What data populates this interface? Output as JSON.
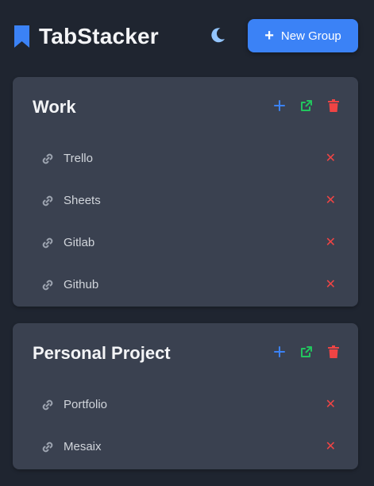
{
  "app": {
    "title": "TabStacker",
    "new_group_label": "New Group",
    "accent": "#3b82f6"
  },
  "icons": {
    "brand": "bookmark-icon",
    "theme": "moon-icon",
    "add": "plus-icon",
    "open": "external-link-icon",
    "delete": "trash-icon",
    "tab": "link-icon",
    "remove": "close-icon"
  },
  "groups": [
    {
      "title": "Work",
      "tabs": [
        {
          "label": "Trello"
        },
        {
          "label": "Sheets"
        },
        {
          "label": "Gitlab"
        },
        {
          "label": "Github"
        }
      ]
    },
    {
      "title": "Personal Project",
      "tabs": [
        {
          "label": "Portfolio"
        },
        {
          "label": "Mesaix"
        }
      ]
    }
  ],
  "colors": {
    "add": "#3b82f6",
    "open": "#22c55e",
    "delete": "#ef4444",
    "remove": "#ef4444"
  }
}
